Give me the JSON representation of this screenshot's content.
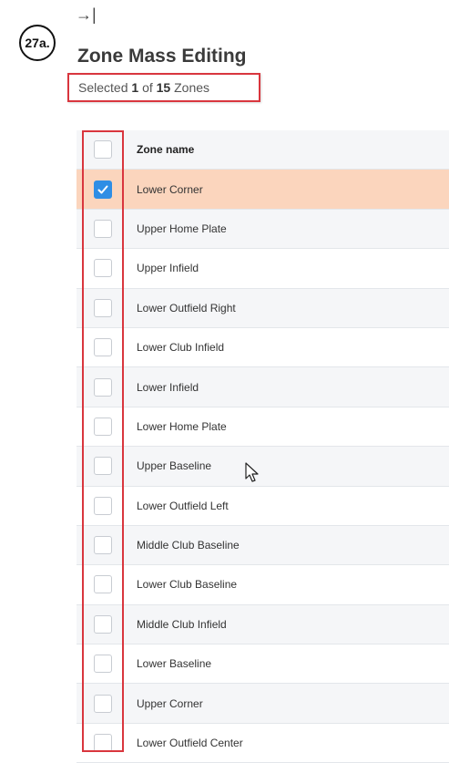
{
  "step_label": "27a.",
  "collapse_glyph": "→|",
  "title": "Zone Mass Editing",
  "summary": {
    "prefix": "Selected",
    "count": "1",
    "of": "of",
    "total": "15",
    "suffix": "Zones"
  },
  "table": {
    "header": "Zone name",
    "rows": [
      {
        "name": "Lower Corner",
        "checked": true
      },
      {
        "name": "Upper Home Plate",
        "checked": false
      },
      {
        "name": "Upper Infield",
        "checked": false
      },
      {
        "name": "Lower Outfield Right",
        "checked": false
      },
      {
        "name": "Lower Club Infield",
        "checked": false
      },
      {
        "name": "Lower Infield",
        "checked": false
      },
      {
        "name": "Lower Home Plate",
        "checked": false
      },
      {
        "name": "Upper Baseline",
        "checked": false
      },
      {
        "name": "Lower Outfield Left",
        "checked": false
      },
      {
        "name": "Middle Club Baseline",
        "checked": false
      },
      {
        "name": "Lower Club Baseline",
        "checked": false
      },
      {
        "name": "Middle Club Infield",
        "checked": false
      },
      {
        "name": "Lower Baseline",
        "checked": false
      },
      {
        "name": "Upper Corner",
        "checked": false
      },
      {
        "name": "Lower Outfield Center",
        "checked": false
      }
    ]
  },
  "colors": {
    "selected_row": "#fbd5bd",
    "checkbox_checked": "#2f8ee5",
    "annotation_red": "#d9363e"
  }
}
